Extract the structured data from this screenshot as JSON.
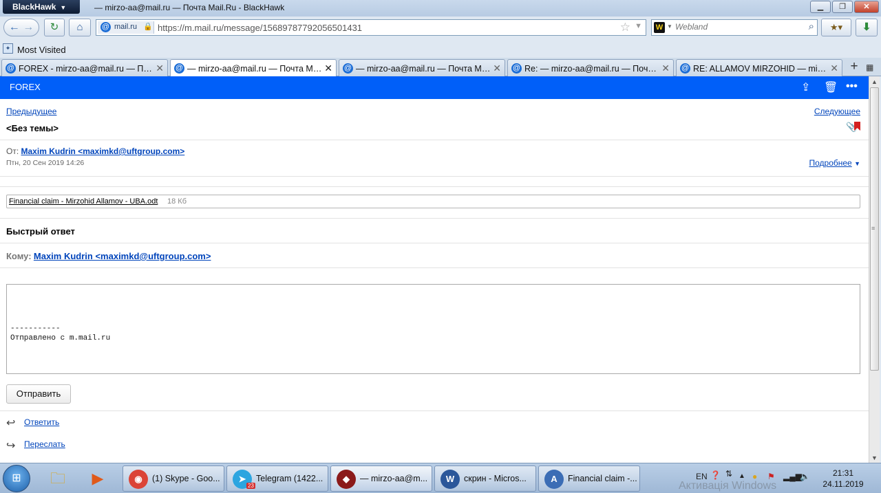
{
  "window": {
    "app_menu": "BlackHawk",
    "title": "— mirzo-aa@mail.ru — Почта Mail.Ru - BlackHawk",
    "controls": {
      "minimize": "▁",
      "restore": "❐",
      "close": "✕"
    }
  },
  "navbar": {
    "site_identity": "mail.ru",
    "url": "https://m.mail.ru/message/15689787792056501431",
    "search_engine_icon": "W",
    "search_placeholder": "Webland"
  },
  "bookmarks": {
    "most_visited": "Most Visited"
  },
  "tabs": [
    {
      "label": "FOREX - mirzo-aa@mail.ru — Почт..."
    },
    {
      "label": "— mirzo-aa@mail.ru — Почта Mail...",
      "active": true
    },
    {
      "label": "— mirzo-aa@mail.ru — Почта Mail..."
    },
    {
      "label": "Re: — mirzo-aa@mail.ru — Почта ..."
    },
    {
      "label": "RE: ALLAMOV MIRZOHID — mirzo-..."
    }
  ],
  "mail": {
    "folder": "FOREX",
    "prev": "Предыдущее",
    "next": "Следующее",
    "subject": "<Без темы>",
    "from_label": "От:",
    "from": "Maxim Kudrin <maximkd@uftgroup.com>",
    "date": "Птн, 20 Сен 2019 14:26",
    "details": "Подробнее",
    "attachment": {
      "name": "Financial claim - Mirzohid Allamov - UBA.odt",
      "size": "18 Кб"
    },
    "quick_reply_title": "Быстрый ответ",
    "to_label": "Кому:",
    "to": "Maxim Kudrin <maximkd@uftgroup.com>",
    "signature": "-----------\nОтправлено с m.mail.ru",
    "send": "Отправить",
    "reply": "Ответить",
    "forward": "Переслать"
  },
  "taskbar": {
    "tasks": [
      {
        "label": "(1) Skype - Goo...",
        "icon_color": "#db4437"
      },
      {
        "label": "Telegram (1422...",
        "icon_color": "#2ca5e0",
        "badge": "23"
      },
      {
        "label": "— mirzo-aa@m...",
        "icon_color": "#8b1a1a",
        "active": true
      },
      {
        "label": "скрин - Micros...",
        "icon_color": "#2b579a"
      },
      {
        "label": "Financial claim -...",
        "icon_color": "#3b6db5"
      }
    ],
    "language": "EN",
    "time": "21:31",
    "date": "24.11.2019",
    "watermark": "Активація Windows"
  }
}
